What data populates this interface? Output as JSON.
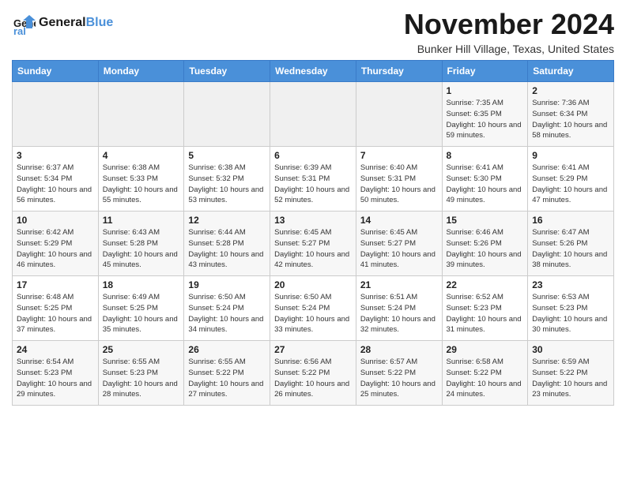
{
  "logo": {
    "text_general": "General",
    "text_blue": "Blue"
  },
  "header": {
    "month": "November 2024",
    "location": "Bunker Hill Village, Texas, United States"
  },
  "weekdays": [
    "Sunday",
    "Monday",
    "Tuesday",
    "Wednesday",
    "Thursday",
    "Friday",
    "Saturday"
  ],
  "weeks": [
    [
      {
        "day": "",
        "info": ""
      },
      {
        "day": "",
        "info": ""
      },
      {
        "day": "",
        "info": ""
      },
      {
        "day": "",
        "info": ""
      },
      {
        "day": "",
        "info": ""
      },
      {
        "day": "1",
        "info": "Sunrise: 7:35 AM\nSunset: 6:35 PM\nDaylight: 10 hours\nand 59 minutes."
      },
      {
        "day": "2",
        "info": "Sunrise: 7:36 AM\nSunset: 6:34 PM\nDaylight: 10 hours\nand 58 minutes."
      }
    ],
    [
      {
        "day": "3",
        "info": "Sunrise: 6:37 AM\nSunset: 5:34 PM\nDaylight: 10 hours\nand 56 minutes."
      },
      {
        "day": "4",
        "info": "Sunrise: 6:38 AM\nSunset: 5:33 PM\nDaylight: 10 hours\nand 55 minutes."
      },
      {
        "day": "5",
        "info": "Sunrise: 6:38 AM\nSunset: 5:32 PM\nDaylight: 10 hours\nand 53 minutes."
      },
      {
        "day": "6",
        "info": "Sunrise: 6:39 AM\nSunset: 5:31 PM\nDaylight: 10 hours\nand 52 minutes."
      },
      {
        "day": "7",
        "info": "Sunrise: 6:40 AM\nSunset: 5:31 PM\nDaylight: 10 hours\nand 50 minutes."
      },
      {
        "day": "8",
        "info": "Sunrise: 6:41 AM\nSunset: 5:30 PM\nDaylight: 10 hours\nand 49 minutes."
      },
      {
        "day": "9",
        "info": "Sunrise: 6:41 AM\nSunset: 5:29 PM\nDaylight: 10 hours\nand 47 minutes."
      }
    ],
    [
      {
        "day": "10",
        "info": "Sunrise: 6:42 AM\nSunset: 5:29 PM\nDaylight: 10 hours\nand 46 minutes."
      },
      {
        "day": "11",
        "info": "Sunrise: 6:43 AM\nSunset: 5:28 PM\nDaylight: 10 hours\nand 45 minutes."
      },
      {
        "day": "12",
        "info": "Sunrise: 6:44 AM\nSunset: 5:28 PM\nDaylight: 10 hours\nand 43 minutes."
      },
      {
        "day": "13",
        "info": "Sunrise: 6:45 AM\nSunset: 5:27 PM\nDaylight: 10 hours\nand 42 minutes."
      },
      {
        "day": "14",
        "info": "Sunrise: 6:45 AM\nSunset: 5:27 PM\nDaylight: 10 hours\nand 41 minutes."
      },
      {
        "day": "15",
        "info": "Sunrise: 6:46 AM\nSunset: 5:26 PM\nDaylight: 10 hours\nand 39 minutes."
      },
      {
        "day": "16",
        "info": "Sunrise: 6:47 AM\nSunset: 5:26 PM\nDaylight: 10 hours\nand 38 minutes."
      }
    ],
    [
      {
        "day": "17",
        "info": "Sunrise: 6:48 AM\nSunset: 5:25 PM\nDaylight: 10 hours\nand 37 minutes."
      },
      {
        "day": "18",
        "info": "Sunrise: 6:49 AM\nSunset: 5:25 PM\nDaylight: 10 hours\nand 35 minutes."
      },
      {
        "day": "19",
        "info": "Sunrise: 6:50 AM\nSunset: 5:24 PM\nDaylight: 10 hours\nand 34 minutes."
      },
      {
        "day": "20",
        "info": "Sunrise: 6:50 AM\nSunset: 5:24 PM\nDaylight: 10 hours\nand 33 minutes."
      },
      {
        "day": "21",
        "info": "Sunrise: 6:51 AM\nSunset: 5:24 PM\nDaylight: 10 hours\nand 32 minutes."
      },
      {
        "day": "22",
        "info": "Sunrise: 6:52 AM\nSunset: 5:23 PM\nDaylight: 10 hours\nand 31 minutes."
      },
      {
        "day": "23",
        "info": "Sunrise: 6:53 AM\nSunset: 5:23 PM\nDaylight: 10 hours\nand 30 minutes."
      }
    ],
    [
      {
        "day": "24",
        "info": "Sunrise: 6:54 AM\nSunset: 5:23 PM\nDaylight: 10 hours\nand 29 minutes."
      },
      {
        "day": "25",
        "info": "Sunrise: 6:55 AM\nSunset: 5:23 PM\nDaylight: 10 hours\nand 28 minutes."
      },
      {
        "day": "26",
        "info": "Sunrise: 6:55 AM\nSunset: 5:22 PM\nDaylight: 10 hours\nand 27 minutes."
      },
      {
        "day": "27",
        "info": "Sunrise: 6:56 AM\nSunset: 5:22 PM\nDaylight: 10 hours\nand 26 minutes."
      },
      {
        "day": "28",
        "info": "Sunrise: 6:57 AM\nSunset: 5:22 PM\nDaylight: 10 hours\nand 25 minutes."
      },
      {
        "day": "29",
        "info": "Sunrise: 6:58 AM\nSunset: 5:22 PM\nDaylight: 10 hours\nand 24 minutes."
      },
      {
        "day": "30",
        "info": "Sunrise: 6:59 AM\nSunset: 5:22 PM\nDaylight: 10 hours\nand 23 minutes."
      }
    ]
  ]
}
